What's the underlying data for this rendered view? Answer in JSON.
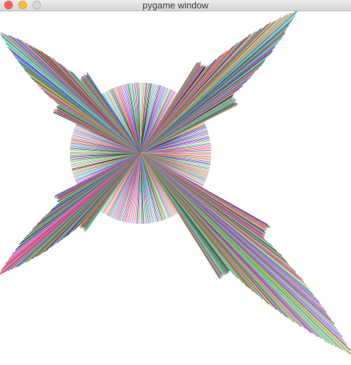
{
  "window": {
    "title": "pygame window",
    "controls": {
      "close_color": "#fc605c",
      "minimize_color": "#fdbc40",
      "zoom_color": "#d6d6d6"
    }
  },
  "canvas": {
    "background": "#ffffff",
    "description_palette": [
      "#e33b3b",
      "#3b8ee3",
      "#5fd35f",
      "#b04ad6",
      "#f2a33a",
      "#3ad1c7",
      "#d63a9a",
      "#7a7a2b",
      "#2b3fa8",
      "#93e0a0",
      "#c98b5a",
      "#6b6bd6",
      "#39a85c",
      "#e07db8",
      "#1f1f1f"
    ]
  }
}
